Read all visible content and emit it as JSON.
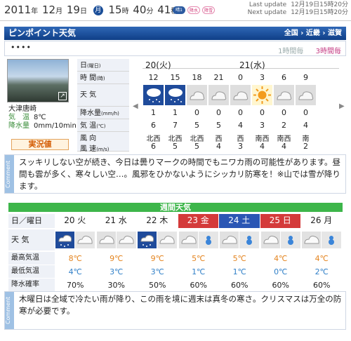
{
  "header": {
    "date_year": "2011",
    "date_month": "12",
    "date_day": "19",
    "weekday": "月",
    "hour": "15",
    "minute": "40",
    "second": "41",
    "unit_year": "年",
    "unit_month": "月",
    "unit_day": "日",
    "unit_hour": "時",
    "unit_minute": "分",
    "unit_second": "秒",
    "pills": [
      "晴1",
      "降水",
      "降雪"
    ],
    "last_update_label": "Last update",
    "last_update": "12月19日15時20分",
    "next_update_label": "Next update",
    "next_update": "12月19日15時20分"
  },
  "panel": {
    "title": "ピンポイント天気",
    "nav": [
      "全国",
      "近畿",
      "滋賀"
    ],
    "dots": "••••",
    "toggle_1h": "1時間毎",
    "toggle_3h": "3時間毎"
  },
  "station": {
    "name": "大津唐崎",
    "temp_label": "気　温",
    "temp": "8℃",
    "precip_label": "降水量",
    "precip": "0mm/10min",
    "live_label": "実況値"
  },
  "rows": {
    "day": "日",
    "day_sub": "(曜日)",
    "time": "時 間",
    "time_sub": "(時)",
    "weather": "天 気",
    "precip": "降水量",
    "precip_sub": "(mm/h)",
    "temp": "気 温",
    "temp_sub": "(℃)",
    "wind": "風 向",
    "wind_sub": "風 速",
    "wind_unit": "(m/s)"
  },
  "days": [
    "20(火)",
    "21(水)"
  ],
  "hours": [
    "12",
    "15",
    "18",
    "21",
    "0",
    "3",
    "6",
    "9"
  ],
  "hourly_weather": [
    "rain",
    "rain",
    "cloud",
    "cloud",
    "cloud",
    "sun",
    "cloud",
    "cloud"
  ],
  "precip": [
    "1",
    "1",
    "0",
    "0",
    "0",
    "0",
    "0",
    "0"
  ],
  "temps": [
    "6",
    "7",
    "5",
    "5",
    "4",
    "3",
    "2",
    "4"
  ],
  "wind_dir": [
    "北西",
    "北西",
    "北西",
    "西",
    "西",
    "南西",
    "南西",
    "南"
  ],
  "wind_speed": [
    "6",
    "5",
    "5",
    "4",
    "3",
    "4",
    "4",
    "2"
  ],
  "comment1_label": "Comment",
  "comment1": "スッキリしない空が続き、今日は曇りマークの時間でもニワカ雨の可能性があります。昼間も雲が多く、寒々しい空…。風邪をひかないようにシッカリ防寒を！※山では雪が降ります。",
  "weekly": {
    "title": "週間天気",
    "col_label": "日／曜日",
    "weather_label": "天 気",
    "max_label": "最高気温",
    "min_label": "最低気温",
    "pop_label": "降水確率",
    "days": [
      {
        "d": "20",
        "w": "火",
        "type": "normal",
        "icon": "rain-cloud"
      },
      {
        "d": "21",
        "w": "水",
        "type": "normal",
        "icon": "cloud"
      },
      {
        "d": "22",
        "w": "木",
        "type": "normal",
        "icon": "cloud-rain"
      },
      {
        "d": "23",
        "w": "金",
        "type": "sun",
        "icon": "cloud-snow"
      },
      {
        "d": "24",
        "w": "土",
        "type": "sat",
        "icon": "cloud-snow"
      },
      {
        "d": "25",
        "w": "日",
        "type": "sun",
        "icon": "cloud-snow"
      },
      {
        "d": "26",
        "w": "月",
        "type": "normal",
        "icon": "cloud-snow"
      }
    ],
    "max": [
      "8℃",
      "9℃",
      "9℃",
      "5℃",
      "5℃",
      "4℃",
      "4℃"
    ],
    "min": [
      "4℃",
      "3℃",
      "3℃",
      "1℃",
      "1℃",
      "0℃",
      "2℃"
    ],
    "pop": [
      "70%",
      "30%",
      "50%",
      "60%",
      "60%",
      "60%",
      "60%"
    ]
  },
  "comment2_label": "Comment",
  "comment2": "木曜日は全域で冷たい雨が降り、この雨を境に週末は真冬の寒さ。クリスマスは万全の防寒が必要です。"
}
